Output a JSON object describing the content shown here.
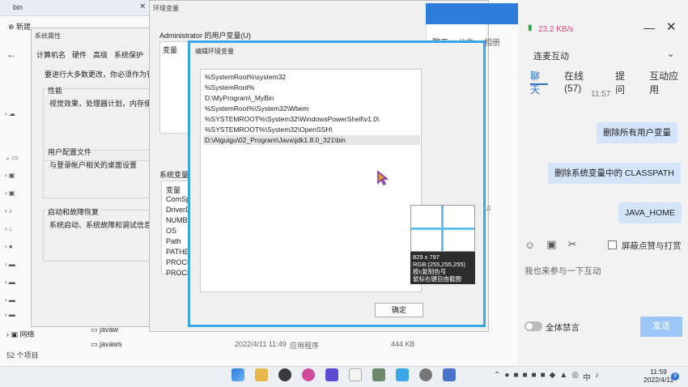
{
  "explorer": {
    "tab_title": "bin",
    "new_label": "新建",
    "network_label": "网络",
    "status_count": "52 个项目",
    "files": [
      "javaw",
      "javaws"
    ],
    "row_date": "2022/4/11 11:49",
    "row_type": "应用程序",
    "row_size": "444 KB"
  },
  "sysprops": {
    "title": "系统属性",
    "tabs": [
      "计算机名",
      "硬件",
      "高级",
      "系统保护",
      "远程"
    ],
    "intro": "要进行大多数更改，你必须作为管理",
    "perf_label": "性能",
    "perf_desc": "视觉效果，处理器计划，内存使用",
    "profile_label": "用户配置文件",
    "profile_desc": "与登录帐户相关的桌面设置",
    "startup_label": "启动和故障恢复",
    "startup_desc": "系统启动、系统故障和调试信息"
  },
  "envvars": {
    "title": "环境变量",
    "user_vars_label": "Administrator 的用户变量(U)",
    "var_col": "变量",
    "sys_vars_label": "系统变量(",
    "sys_var_col": "变量",
    "sys_vars": [
      "ComSp",
      "DriverD",
      "NUMBE",
      "OS",
      "Path",
      "PATHEX",
      "PROCE",
      "PROCE"
    ]
  },
  "edit_dialog": {
    "title": "编辑环境变量",
    "paths": [
      "%SystemRoot%\\system32",
      "%SystemRoot%",
      "D:\\MyProgram\\_MyBin",
      "%SystemRoot%\\System32\\Wbem",
      "%SYSTEMROOT%\\System32\\WindowsPowerShell\\v1.0\\",
      "%SYSTEMROOT%\\System32\\OpenSSH\\",
      "D:\\Atguigu\\02_Program\\Java\\jdk1.8.0_321\\bin"
    ],
    "selected_index": 6,
    "ok_label": "确定"
  },
  "picker": {
    "coords": "829 x 797",
    "rgb": "RGB:(255,255,255)",
    "hint1": "按c复制色号",
    "hint2": "鼠标右键自由截图",
    "crosshair_color": "#5fc1f0"
  },
  "chat": {
    "speed": "23.2 KB/s",
    "side_tabs": [
      "聊天",
      "公告",
      "相册"
    ],
    "subtitle": "连麦互动",
    "tabs": [
      "聊天",
      "在线(57)",
      "提问",
      "互动应用"
    ],
    "time": "11:57",
    "messages": [
      "删除所有用户变量",
      "删除系统变量中的 CLASSPATH",
      "JAVA_HOME"
    ],
    "mask_label": "屏蔽点赞与打赏",
    "input_placeholder": "我也来参与一下互动",
    "mute_label": "全体禁言",
    "send_label": "发送",
    "accent": "#2d70c8",
    "bubble_color": "#d4e5fb"
  },
  "taskbar": {
    "time": "11:59",
    "date": "2022/4/11",
    "badge": "9",
    "lang": "中"
  }
}
